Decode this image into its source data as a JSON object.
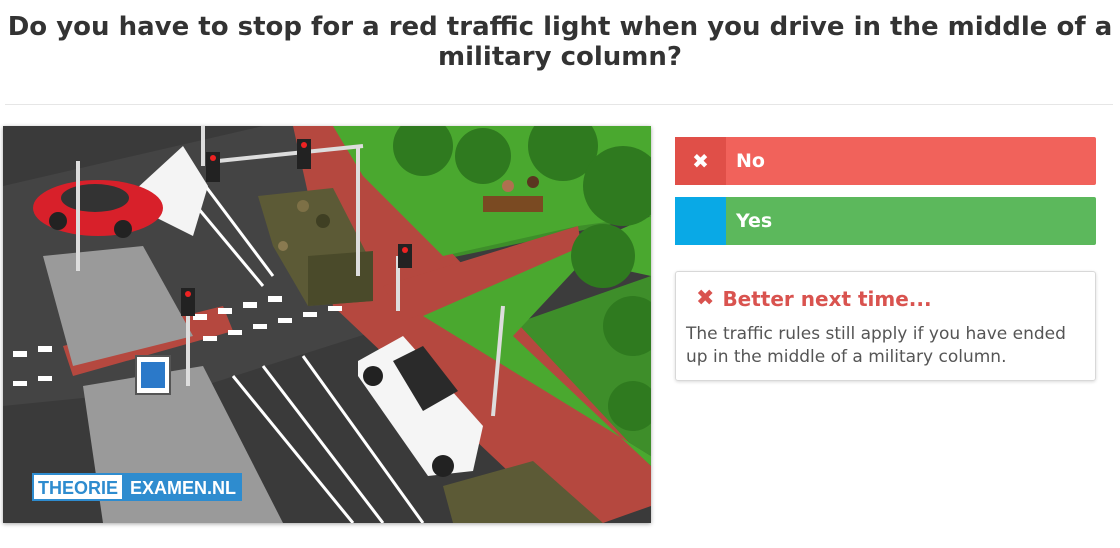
{
  "question": "Do you have to stop for a red traffic light when you drive in the middle of a military column?",
  "image": {
    "alt_logo_part1": "THEORIE",
    "alt_logo_part2": "EXAMEN.NL"
  },
  "answers": [
    {
      "label": "No",
      "icon": "x-icon",
      "mark": "✖",
      "state": "selected-wrong"
    },
    {
      "label": "Yes",
      "icon": "none",
      "mark": "",
      "state": "correct"
    }
  ],
  "feedback": {
    "title": "Better next time...",
    "icon": "x-icon",
    "icon_glyph": "✖",
    "text": "The traffic rules still apply if you have ended up in the middle of a military column."
  },
  "colors": {
    "wrong": "#f1625b",
    "correct": "#5cb85c",
    "yes_mark": "#09a9e6",
    "feedback_title": "#d9534f"
  }
}
